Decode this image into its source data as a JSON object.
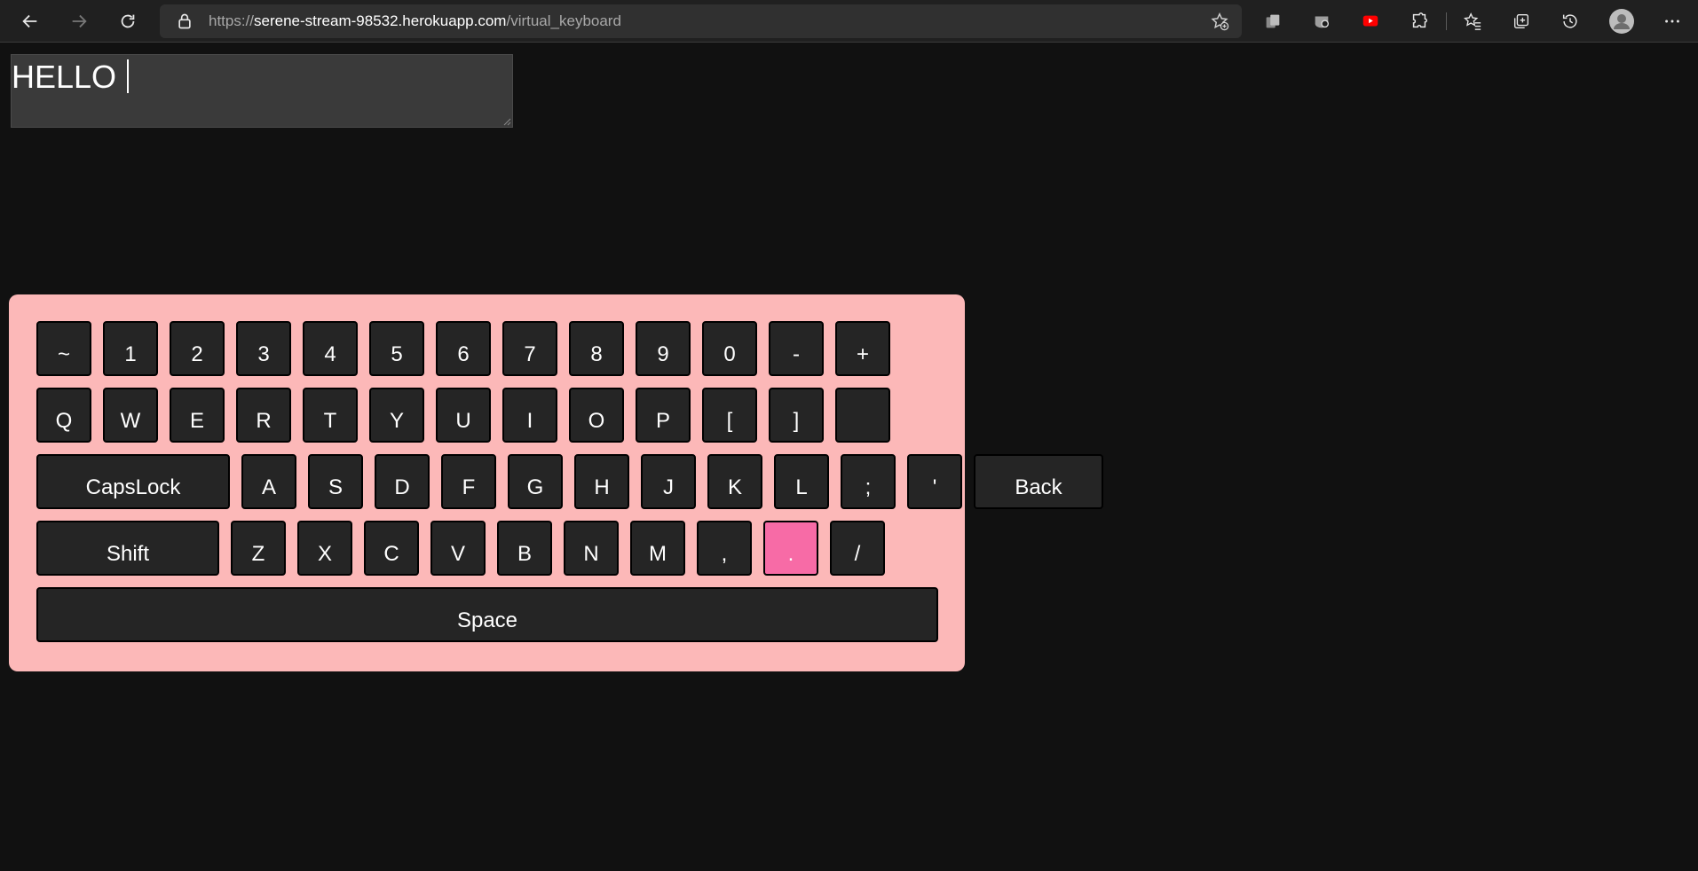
{
  "browser": {
    "url_protocol": "https://",
    "url_domain": "serene-stream-98532.herokuapp.com",
    "url_path": "/virtual_keyboard",
    "youtube_color": "#ff0000"
  },
  "textarea": {
    "value": "HELLO "
  },
  "keyboard": {
    "background": "#fcb8b8",
    "active_key_color": "#f76ba6",
    "rows": [
      [
        "~",
        "1",
        "2",
        "3",
        "4",
        "5",
        "6",
        "7",
        "8",
        "9",
        "0",
        "-",
        "+"
      ],
      [
        "Q",
        "W",
        "E",
        "R",
        "T",
        "Y",
        "U",
        "I",
        "O",
        "P",
        "[",
        "]",
        ""
      ],
      [
        "CapsLock",
        "A",
        "S",
        "D",
        "F",
        "G",
        "H",
        "J",
        "K",
        "L",
        ";",
        "'",
        "Back"
      ],
      [
        "Shift",
        "Z",
        "X",
        "C",
        "V",
        "B",
        "N",
        "M",
        ",",
        ".",
        "/"
      ],
      [
        "Space"
      ]
    ],
    "active_key": "."
  }
}
